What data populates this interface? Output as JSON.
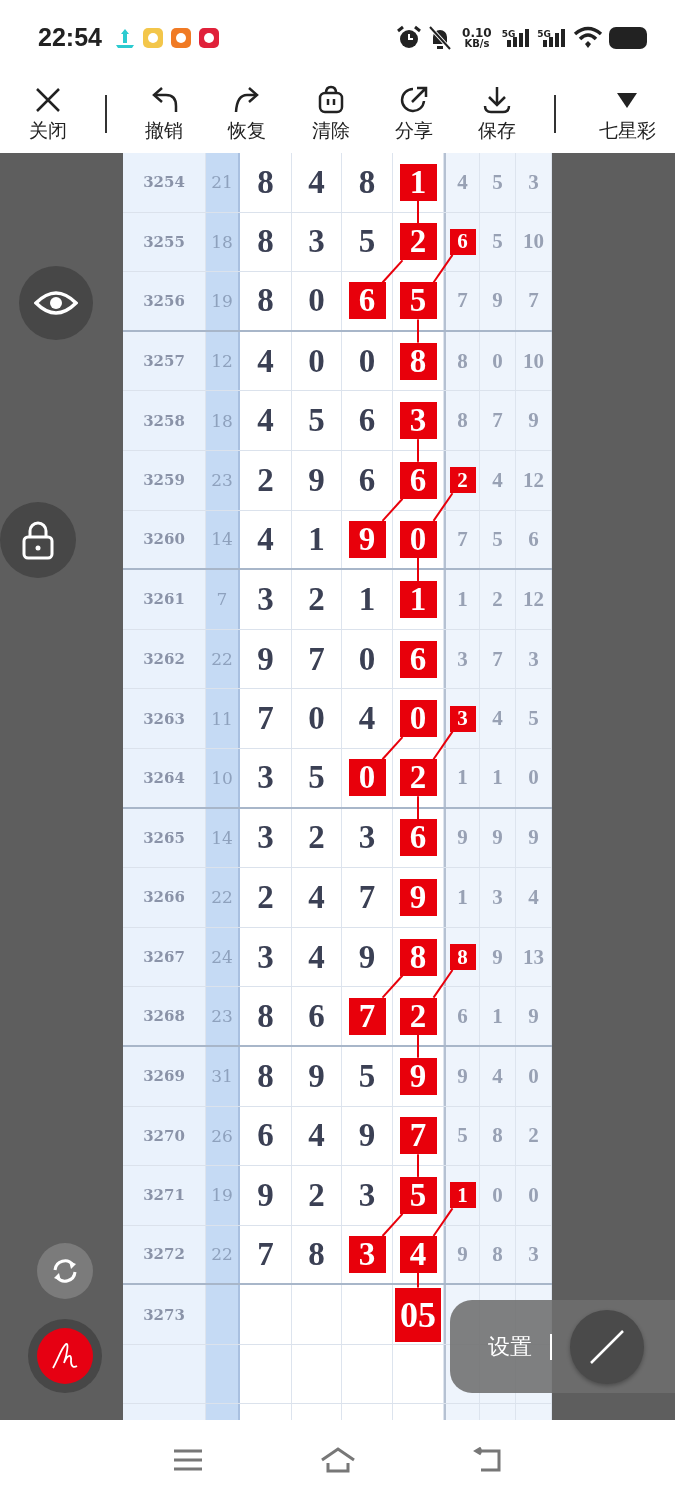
{
  "status_bar": {
    "time": "22:54",
    "net_speed": "0.10",
    "net_unit": "KB/s",
    "signals": [
      "5G",
      "5G"
    ]
  },
  "toolbar": [
    {
      "kind": "close",
      "label": "关闭"
    },
    {
      "kind": "undo",
      "label": "撤销"
    },
    {
      "kind": "redo",
      "label": "恢复"
    },
    {
      "kind": "clear",
      "label": "清除"
    },
    {
      "kind": "share",
      "label": "分享"
    },
    {
      "kind": "save",
      "label": "保存"
    },
    {
      "kind": "dropdown",
      "label": "七星彩"
    }
  ],
  "rows": [
    {
      "issue": "3254",
      "sum": "21",
      "cells": [
        {
          "value": "8",
          "marked": false
        },
        {
          "value": "4",
          "marked": false
        },
        {
          "value": "8",
          "marked": false
        },
        {
          "value": "1",
          "marked": true,
          "linked": true
        },
        {
          "value": "4",
          "marked": false
        },
        {
          "value": "5",
          "marked": false
        },
        {
          "value": "3",
          "marked": false
        }
      ]
    },
    {
      "issue": "3255",
      "sum": "18",
      "cells": [
        {
          "value": "8",
          "marked": false
        },
        {
          "value": "3",
          "marked": false
        },
        {
          "value": "5",
          "marked": false
        },
        {
          "value": "2",
          "marked": true,
          "linked": true
        },
        {
          "value": "6",
          "marked": true,
          "linked": true
        },
        {
          "value": "5",
          "marked": false
        },
        {
          "value": "10",
          "marked": false
        }
      ]
    },
    {
      "issue": "3256",
      "sum": "19",
      "cells": [
        {
          "value": "8",
          "marked": false
        },
        {
          "value": "0",
          "marked": false
        },
        {
          "value": "6",
          "marked": true,
          "linked": false
        },
        {
          "value": "5",
          "marked": true,
          "linked": true
        },
        {
          "value": "7",
          "marked": false
        },
        {
          "value": "9",
          "marked": false
        },
        {
          "value": "7",
          "marked": false
        }
      ]
    },
    {
      "issue": "3257",
      "sum": "12",
      "cells": [
        {
          "value": "4",
          "marked": false
        },
        {
          "value": "0",
          "marked": false
        },
        {
          "value": "0",
          "marked": false
        },
        {
          "value": "8",
          "marked": true,
          "linked": false
        },
        {
          "value": "8",
          "marked": false
        },
        {
          "value": "0",
          "marked": false
        },
        {
          "value": "10",
          "marked": false
        }
      ]
    },
    {
      "issue": "3258",
      "sum": "18",
      "cells": [
        {
          "value": "4",
          "marked": false
        },
        {
          "value": "5",
          "marked": false
        },
        {
          "value": "6",
          "marked": false
        },
        {
          "value": "3",
          "marked": true,
          "linked": true
        },
        {
          "value": "8",
          "marked": false
        },
        {
          "value": "7",
          "marked": false
        },
        {
          "value": "9",
          "marked": false
        }
      ]
    },
    {
      "issue": "3259",
      "sum": "23",
      "cells": [
        {
          "value": "2",
          "marked": false
        },
        {
          "value": "9",
          "marked": false
        },
        {
          "value": "6",
          "marked": false
        },
        {
          "value": "6",
          "marked": true,
          "linked": true
        },
        {
          "value": "2",
          "marked": true,
          "linked": true
        },
        {
          "value": "4",
          "marked": false
        },
        {
          "value": "12",
          "marked": false
        }
      ]
    },
    {
      "issue": "3260",
      "sum": "14",
      "cells": [
        {
          "value": "4",
          "marked": false
        },
        {
          "value": "1",
          "marked": false
        },
        {
          "value": "9",
          "marked": true,
          "linked": false
        },
        {
          "value": "0",
          "marked": true,
          "linked": true
        },
        {
          "value": "7",
          "marked": false
        },
        {
          "value": "5",
          "marked": false
        },
        {
          "value": "6",
          "marked": false
        }
      ]
    },
    {
      "issue": "3261",
      "sum": "7",
      "cells": [
        {
          "value": "3",
          "marked": false
        },
        {
          "value": "2",
          "marked": false
        },
        {
          "value": "1",
          "marked": false
        },
        {
          "value": "1",
          "marked": true,
          "linked": false
        },
        {
          "value": "1",
          "marked": false
        },
        {
          "value": "2",
          "marked": false
        },
        {
          "value": "12",
          "marked": false
        }
      ]
    },
    {
      "issue": "3262",
      "sum": "22",
      "cells": [
        {
          "value": "9",
          "marked": false
        },
        {
          "value": "7",
          "marked": false
        },
        {
          "value": "0",
          "marked": false
        },
        {
          "value": "6",
          "marked": true,
          "linked": false
        },
        {
          "value": "3",
          "marked": false
        },
        {
          "value": "7",
          "marked": false
        },
        {
          "value": "3",
          "marked": false
        }
      ]
    },
    {
      "issue": "3263",
      "sum": "11",
      "cells": [
        {
          "value": "7",
          "marked": false
        },
        {
          "value": "0",
          "marked": false
        },
        {
          "value": "4",
          "marked": false
        },
        {
          "value": "0",
          "marked": true,
          "linked": true
        },
        {
          "value": "3",
          "marked": true,
          "linked": true
        },
        {
          "value": "4",
          "marked": false
        },
        {
          "value": "5",
          "marked": false
        }
      ]
    },
    {
      "issue": "3264",
      "sum": "10",
      "cells": [
        {
          "value": "3",
          "marked": false
        },
        {
          "value": "5",
          "marked": false
        },
        {
          "value": "0",
          "marked": true,
          "linked": false
        },
        {
          "value": "2",
          "marked": true,
          "linked": true
        },
        {
          "value": "1",
          "marked": false
        },
        {
          "value": "1",
          "marked": false
        },
        {
          "value": "0",
          "marked": false
        }
      ]
    },
    {
      "issue": "3265",
      "sum": "14",
      "cells": [
        {
          "value": "3",
          "marked": false
        },
        {
          "value": "2",
          "marked": false
        },
        {
          "value": "3",
          "marked": false
        },
        {
          "value": "6",
          "marked": true,
          "linked": false
        },
        {
          "value": "9",
          "marked": false
        },
        {
          "value": "9",
          "marked": false
        },
        {
          "value": "9",
          "marked": false
        }
      ]
    },
    {
      "issue": "3266",
      "sum": "22",
      "cells": [
        {
          "value": "2",
          "marked": false
        },
        {
          "value": "4",
          "marked": false
        },
        {
          "value": "7",
          "marked": false
        },
        {
          "value": "9",
          "marked": true,
          "linked": false
        },
        {
          "value": "1",
          "marked": false
        },
        {
          "value": "3",
          "marked": false
        },
        {
          "value": "4",
          "marked": false
        }
      ]
    },
    {
      "issue": "3267",
      "sum": "24",
      "cells": [
        {
          "value": "3",
          "marked": false
        },
        {
          "value": "4",
          "marked": false
        },
        {
          "value": "9",
          "marked": false
        },
        {
          "value": "8",
          "marked": true,
          "linked": true
        },
        {
          "value": "8",
          "marked": true,
          "linked": true
        },
        {
          "value": "9",
          "marked": false
        },
        {
          "value": "13",
          "marked": false
        }
      ]
    },
    {
      "issue": "3268",
      "sum": "23",
      "cells": [
        {
          "value": "8",
          "marked": false
        },
        {
          "value": "6",
          "marked": false
        },
        {
          "value": "7",
          "marked": true,
          "linked": false
        },
        {
          "value": "2",
          "marked": true,
          "linked": true
        },
        {
          "value": "6",
          "marked": false
        },
        {
          "value": "1",
          "marked": false
        },
        {
          "value": "9",
          "marked": false
        }
      ]
    },
    {
      "issue": "3269",
      "sum": "31",
      "cells": [
        {
          "value": "8",
          "marked": false
        },
        {
          "value": "9",
          "marked": false
        },
        {
          "value": "5",
          "marked": false
        },
        {
          "value": "9",
          "marked": true,
          "linked": false
        },
        {
          "value": "9",
          "marked": false
        },
        {
          "value": "4",
          "marked": false
        },
        {
          "value": "0",
          "marked": false
        }
      ]
    },
    {
      "issue": "3270",
      "sum": "26",
      "cells": [
        {
          "value": "6",
          "marked": false
        },
        {
          "value": "4",
          "marked": false
        },
        {
          "value": "9",
          "marked": false
        },
        {
          "value": "7",
          "marked": true,
          "linked": true
        },
        {
          "value": "5",
          "marked": false
        },
        {
          "value": "8",
          "marked": false
        },
        {
          "value": "2",
          "marked": false
        }
      ]
    },
    {
      "issue": "3271",
      "sum": "19",
      "cells": [
        {
          "value": "9",
          "marked": false
        },
        {
          "value": "2",
          "marked": false
        },
        {
          "value": "3",
          "marked": false
        },
        {
          "value": "5",
          "marked": true,
          "linked": true
        },
        {
          "value": "1",
          "marked": true,
          "linked": true
        },
        {
          "value": "0",
          "marked": false
        },
        {
          "value": "0",
          "marked": false
        }
      ]
    },
    {
      "issue": "3272",
      "sum": "22",
      "cells": [
        {
          "value": "7",
          "marked": false
        },
        {
          "value": "8",
          "marked": false
        },
        {
          "value": "3",
          "marked": true,
          "linked": false
        },
        {
          "value": "4",
          "marked": true,
          "linked": true
        },
        {
          "value": "9",
          "marked": false
        },
        {
          "value": "8",
          "marked": false
        },
        {
          "value": "3",
          "marked": false
        }
      ]
    },
    {
      "issue": "3273",
      "cells": [
        null,
        null,
        null,
        {
          "value": "05",
          "marked": true
        },
        null,
        null,
        null
      ]
    }
  ],
  "settings_panel": {
    "label": "设置"
  }
}
